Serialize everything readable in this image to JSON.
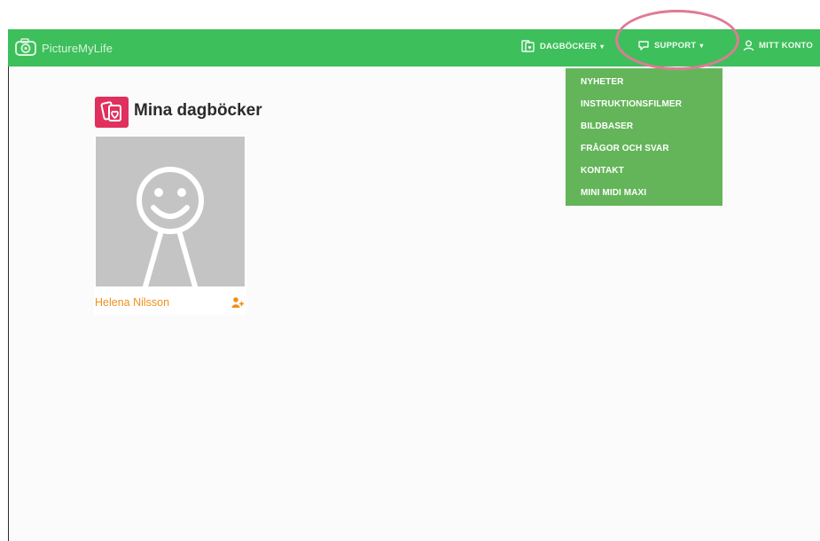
{
  "app": {
    "brand_name": "PictureMyLife"
  },
  "nav": {
    "items": [
      {
        "label": "DAGBÖCKER",
        "icon": "diary-icon",
        "has_caret": true
      },
      {
        "label": "SUPPORT",
        "icon": "speech-bubble-icon",
        "has_caret": true
      },
      {
        "label": "MITT KONTO",
        "icon": "user-icon",
        "has_caret": false
      }
    ],
    "caret_glyph": "▾"
  },
  "support_menu": {
    "items": [
      "NYHETER",
      "INSTRUKTIONSFILMER",
      "BILDBASER",
      "FRÅGOR OCH SVAR",
      "KONTAKT",
      "MINI MIDI MAXI"
    ]
  },
  "section": {
    "title": "Mina dagböcker",
    "icon": "diaries-heart-icon"
  },
  "diary_card": {
    "name": "Helena Nilsson",
    "avatar_icon": "smiley-stick-figure-icon",
    "action_icon": "add-user-icon"
  },
  "colors": {
    "navbar": "#3dbf5b",
    "dropdown": "#64b55a",
    "accent_orange": "#f0901c",
    "section_icon_bg": "#e0305d",
    "highlight_circle": "#e07a95"
  }
}
